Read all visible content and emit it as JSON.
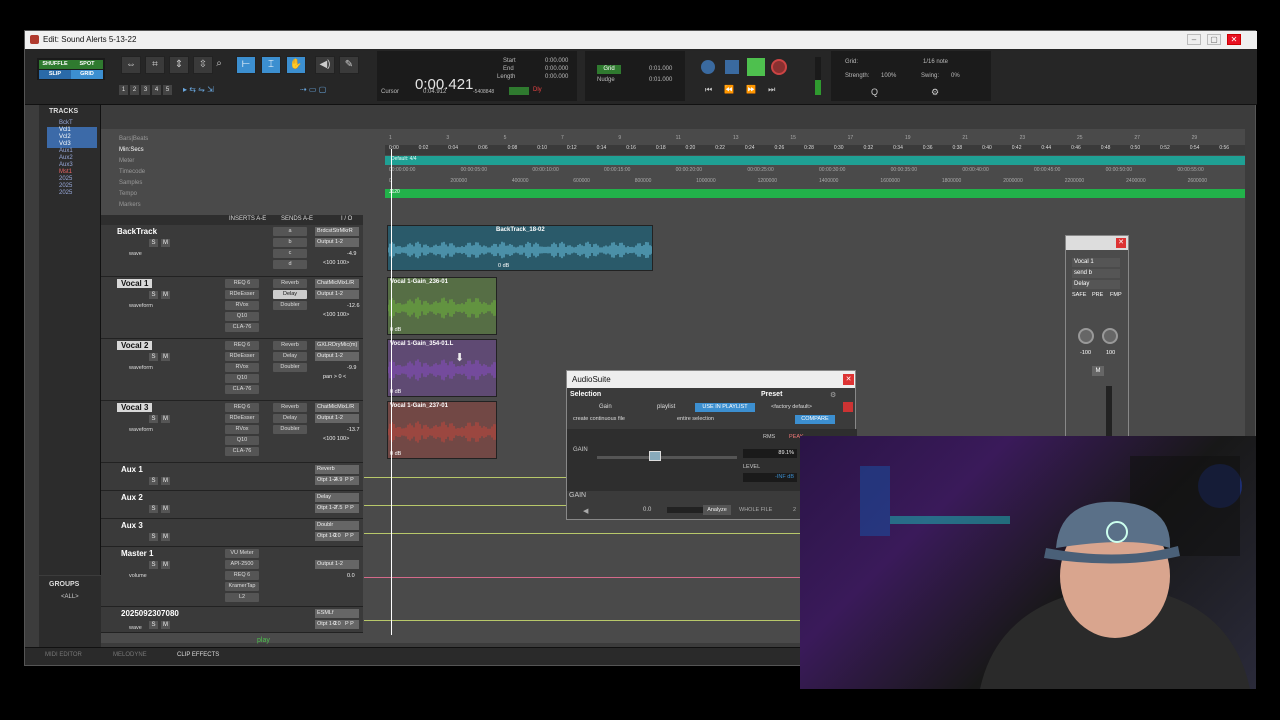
{
  "window": {
    "title": "Edit: Sound Alerts 5-13-22"
  },
  "toolbar": {
    "modes": [
      "SHUFFLE",
      "SPOT",
      "SLIP",
      "GRID"
    ],
    "numbers": [
      "1",
      "2",
      "3",
      "4",
      "5"
    ],
    "counter_main": "0:00.421",
    "cursor_label": "Cursor",
    "cursor_value": "0:04.912",
    "cursor_sample": "-5408848",
    "start_label": "Start",
    "end_label": "End",
    "length_label": "Length",
    "start_value": "0:00.000",
    "end_value": "0:00.000",
    "length_value": "0:00.000",
    "grid_label": "Grid",
    "grid_value": "0:01.000",
    "nudge_label": "Nudge",
    "nudge_value": "0:01.000",
    "dly_label": "Dly",
    "grid2_label": "Grid:",
    "grid2_value": "1/16 note",
    "strength_label": "Strength:",
    "strength_value": "100%",
    "swing_label": "Swing:",
    "swing_value": "0%"
  },
  "tracklist": {
    "header": "TRACKS",
    "items": [
      "BckT",
      "Vcl1",
      "Vcl2",
      "Vcl3",
      "Aux1",
      "Aux2",
      "Aux3",
      "Mst1",
      "2025",
      "2025",
      "2025"
    ]
  },
  "groups": {
    "header": "GROUPS",
    "all": "<ALL>"
  },
  "rulers": [
    "Bars|Beats",
    "Min:Secs",
    "Meter",
    "Timecode",
    "Samples",
    "Tempo",
    "Markers"
  ],
  "ruler_meter_value": "Default: 4/4",
  "ruler_tempo_value": "J120",
  "ruler_minsec_ticks": [
    "0:00",
    "0:02",
    "0:04",
    "0:06",
    "0:08",
    "0:10",
    "0:12",
    "0:14",
    "0:16",
    "0:18",
    "0:20",
    "0:22",
    "0:24",
    "0:26",
    "0:28",
    "0:30",
    "0:32",
    "0:34",
    "0:36",
    "0:38",
    "0:40",
    "0:42",
    "0:44",
    "0:46",
    "0:48",
    "0:50",
    "0:52",
    "0:54",
    "0:56"
  ],
  "ruler_bar_ticks": [
    "1",
    "3",
    "5",
    "7",
    "9",
    "11",
    "13",
    "15",
    "17",
    "19",
    "21",
    "23",
    "25",
    "27",
    "29"
  ],
  "ruler_timecode_ticks": [
    "00:00:00:00",
    "00:00:05:00",
    "00:00:10:00",
    "00:00:15:00",
    "00:00:20:00",
    "00:00:25:00",
    "00:00:30:00",
    "00:00:35:00",
    "00:00:40:00",
    "00:00:45:00",
    "00:00:50:00",
    "00:00:55:00"
  ],
  "ruler_sample_ticks": [
    "0",
    "200000",
    "400000",
    "600000",
    "800000",
    "1000000",
    "1200000",
    "1400000",
    "1600000",
    "1800000",
    "2000000",
    "2200000",
    "2400000",
    "2600000"
  ],
  "column_headers": {
    "inserts": "INSERTS A-E",
    "sends": "SENDS A-E",
    "io": "I / O"
  },
  "tracks": [
    {
      "name": "BackTrack",
      "inserts": [],
      "sends": [
        "a",
        "b",
        "c",
        "d"
      ],
      "input": "BrdcstStrMkrR",
      "output": "Output 1-2",
      "vol": "-4.9",
      "pan": "<100 100>",
      "view": "wave"
    },
    {
      "name": "Vocal 1",
      "inserts": [
        "REQ 6",
        "RDeEsser",
        "RVox",
        "Q10",
        "CLA-76"
      ],
      "sends": [
        "Reverb",
        "Delay",
        "Doubler",
        "",
        ""
      ],
      "input": "ChatMicMixL/R",
      "output": "Output 1-2",
      "vol": "-12.6",
      "pan": "<100 100>",
      "view": "waveform"
    },
    {
      "name": "Vocal 2",
      "inserts": [
        "REQ 6",
        "RDeEsser",
        "RVox",
        "Q10",
        "CLA-76"
      ],
      "sends": [
        "Reverb",
        "Delay",
        "Doubler",
        "",
        ""
      ],
      "input": "GXLRDryMic(m)",
      "output": "Output 1-2",
      "vol": "-9.9",
      "pan": "pan > 0 <",
      "view": "waveform"
    },
    {
      "name": "Vocal 3",
      "inserts": [
        "REQ 6",
        "RDeEsser",
        "RVox",
        "Q10",
        "CLA-76"
      ],
      "sends": [
        "Reverb",
        "Delay",
        "Doubler",
        "",
        ""
      ],
      "input": "ChatMicMixL/R",
      "output": "Output 1-2",
      "vol": "-13.7",
      "pan": "<100 100>",
      "view": "waveform"
    },
    {
      "name": "Aux 1",
      "inserts": [],
      "sends": [],
      "input": "Reverb",
      "output": "Otpt 1-2",
      "vol": "-4.9",
      "pan": "P P",
      "view": ""
    },
    {
      "name": "Aux 2",
      "inserts": [],
      "sends": [],
      "input": "Delay",
      "output": "Otpt 1-2",
      "vol": "-7.5",
      "pan": "P P",
      "view": ""
    },
    {
      "name": "Aux 3",
      "inserts": [],
      "sends": [],
      "input": "Doublr",
      "output": "Otpt 1-2",
      "vol": "0.0",
      "pan": "P P",
      "view": ""
    },
    {
      "name": "Master 1",
      "inserts": [
        "VU Meter",
        "API-2500",
        "REQ 6",
        "KramerTap",
        "L2"
      ],
      "sends": [],
      "input": "",
      "output": "Output 1-2",
      "vol": "0.0",
      "pan": "",
      "view": "volume"
    },
    {
      "name": "2025092307080",
      "inserts": [],
      "sends": [],
      "input": "ESMLf",
      "output": "Otpt 1-2",
      "vol": "0.0",
      "pan": "P P",
      "view": "wave"
    }
  ],
  "clips": [
    {
      "name": "BackTrack_18-02",
      "gain": "0 dB",
      "color": "#4aa6c8"
    },
    {
      "name": "Vocal 1-Gain_236-01",
      "gain": "0 dB",
      "color": "#6fb83c"
    },
    {
      "name": "Vocal 1-Gain_354-01.L",
      "gain": "0 dB",
      "color": "#8a4cc6"
    },
    {
      "name": "Vocal 1-Gain_237-01",
      "gain": "0 dB",
      "color": "#c4463c"
    }
  ],
  "audiosuite": {
    "title": "AudioSuite",
    "selection_label": "Selection",
    "preset_label": "Preset",
    "plugin": "Gain",
    "playlist": "playlist",
    "use_in_playlist": "USE IN PLAYLIST",
    "factory_default": "<factory default>",
    "create_continuous": "create continuous file",
    "entire_selection": "entire selection",
    "compare": "COMPARE",
    "rms": "RMS",
    "peak": "PEAK",
    "gain_label": "GAIN",
    "gain_value": "89.1%",
    "level_label": "LEVEL",
    "level_value": "-INF dB",
    "footer_gain": "GAIN",
    "zero": "0.0",
    "analyze": "Analyze",
    "whole_file": "WHOLE FILE",
    "count": "2"
  },
  "plugin_window": {
    "track": "Vocal 1",
    "send": "send b",
    "plugin": "Delay",
    "safe": "SAFE",
    "pre": "PRE",
    "fmp": "FMP",
    "pan_left": "-100",
    "pan_right": "100",
    "m_label": "M"
  },
  "bottom_tabs": [
    "MIDI EDITOR",
    "MELODYNE",
    "CLIP EFFECTS"
  ],
  "play_label": "play",
  "colors": {
    "accent": "#3c8fd0",
    "green": "#4ec04e",
    "clip_blue": "#4aa6c8"
  }
}
